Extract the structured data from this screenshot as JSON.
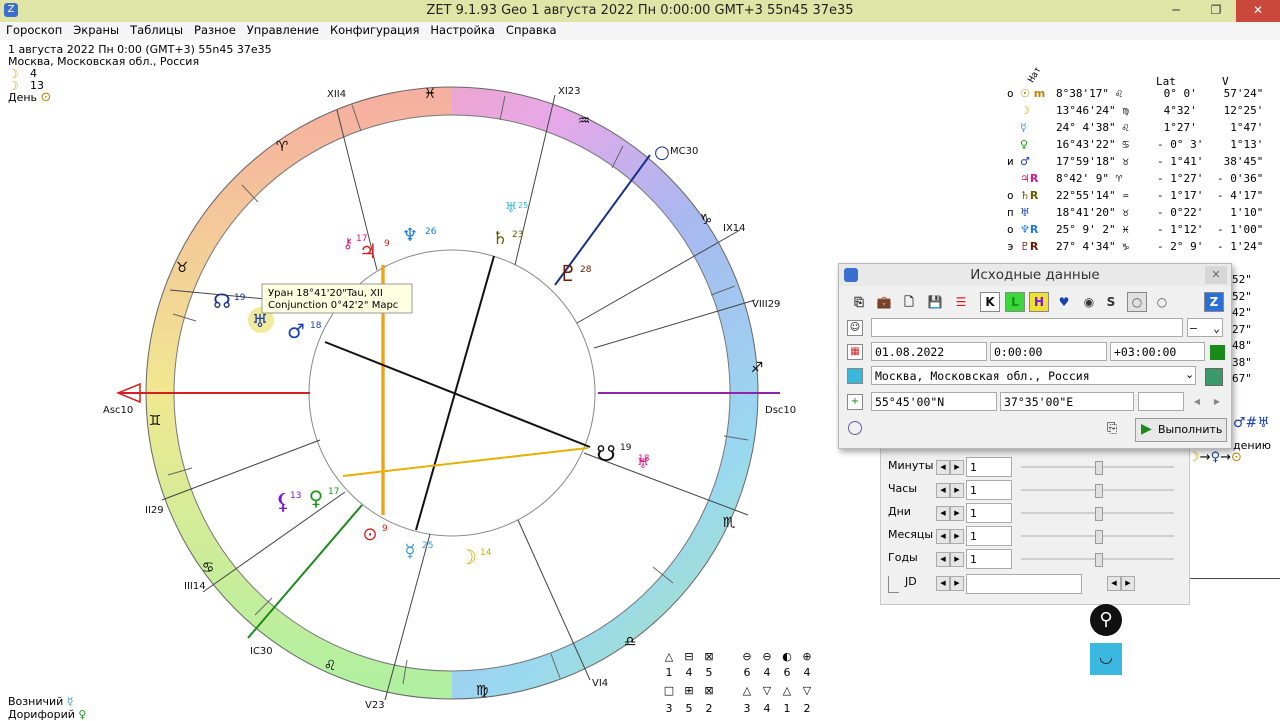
{
  "window": {
    "title": "ZET 9.1.93 Geo     1 августа 2022  Пн    0:00:00 GMT+3 55n45  37e35",
    "min": "─",
    "max": "❐",
    "close": "✕"
  },
  "menu": [
    "Гороскоп",
    "Экраны",
    "Таблицы",
    "Разное",
    "Управление",
    "Конфигурация",
    "Настройка",
    "Справка"
  ],
  "chart_info": {
    "line1": "1 августа 2022  Пн   0:00 (GMT+3) 55n45  37e35",
    "line2": "Москва, Московская обл., Россия",
    "moon_day": "4",
    "sun_day": "13",
    "day_label": "День"
  },
  "wheel": {
    "houses": [
      "Asc10",
      "XII4",
      "XI23",
      "MC30",
      "IX14",
      "VIII29",
      "Dsc10",
      "VI4",
      "V23",
      "IC30",
      "III14",
      "II29"
    ],
    "tooltip_line1": "Уран 18°41'20\"Tau, XII",
    "tooltip_line2": "Conjunction 0°42'2\" Марс",
    "planet_labels": {
      "sun": "9",
      "moon": "14",
      "mercury": "25",
      "venus": "17",
      "mars": "18",
      "jupiter": "9",
      "saturn": "23",
      "uranus": "19",
      "neptune": "26",
      "pluto": "28",
      "node": "19",
      "snode": "19",
      "lilith": "13",
      "chiron": "17",
      "cupido": "25",
      "mcnode": "18"
    }
  },
  "planet_table": {
    "header_nat": "Нат",
    "header_lat": "Lat",
    "header_v": "V",
    "rows": [
      {
        "m": "о",
        "g": "☉ m",
        "pos": "8°38'17\" ♌",
        "lat": " 0° 0'",
        "v": " 57'24\"",
        "color": "#c08000"
      },
      {
        "m": "",
        "g": "☽",
        "pos": "13°46'24\" ♍",
        "lat": " 4°32'",
        "v": " 12°25'",
        "color": "#d4a900"
      },
      {
        "m": "",
        "g": "☿",
        "pos": "24° 4'38\" ♌",
        "lat": " 1°27'",
        "v": "  1°47'",
        "color": "#3a9ad9"
      },
      {
        "m": "",
        "g": "♀",
        "pos": "16°43'22\" ♋",
        "lat": "- 0° 3'",
        "v": "  1°13'",
        "color": "#1a9a1a"
      },
      {
        "m": "и",
        "g": "♂",
        "pos": "17°59'18\" ♉",
        "lat": "- 1°41'",
        "v": " 38'45\"",
        "color": "#1a3fae"
      },
      {
        "m": "",
        "g": "♃R",
        "pos": "8°42' 9\" ♈",
        "lat": "- 1°27'",
        "v": "- 0'36\"",
        "color": "#d6168a"
      },
      {
        "m": "о",
        "g": "♄R",
        "pos": "22°55'14\" ♒",
        "lat": "- 1°17'",
        "v": "- 4'17\"",
        "color": "#6a5a00"
      },
      {
        "m": "п",
        "g": "♅",
        "pos": "18°41'20\" ♉",
        "lat": "- 0°22'",
        "v": "  1'10\"",
        "color": "#1a3fae"
      },
      {
        "m": "о",
        "g": "♆R",
        "pos": "25° 9' 2\" ♓",
        "lat": "- 1°12'",
        "v": "- 1'00\"",
        "color": "#1a7ad9"
      },
      {
        "m": "э",
        "g": "♇R",
        "pos": "27° 4'34\" ♑",
        "lat": "- 2° 9'",
        "v": "- 1'24\"",
        "color": "#6a1a00"
      }
    ],
    "partial_v": [
      "52\"",
      "52\"",
      "42\"",
      "27\"",
      "48\"",
      "38\"",
      "67\""
    ]
  },
  "dialog": {
    "title": "Исходные данные",
    "close": "✕",
    "toolbar": [
      "⎘",
      "💼",
      "🗋",
      "💾",
      "☰",
      "K",
      "L",
      "H",
      "♥",
      "◉",
      "S",
      "○",
      "○",
      "Z"
    ],
    "name_value": "",
    "name_drop": "—",
    "date": "01.08.2022",
    "time": "0:00:00",
    "tz": "+03:00:00",
    "place": "Москва, Московская обл., Россия",
    "lat": "55°45'00\"N",
    "lon": "37°35'00\"E",
    "coord_extra": "",
    "run_label": "Выполнить"
  },
  "step_panel": {
    "rows": [
      {
        "label": "Минуты",
        "value": "1"
      },
      {
        "label": "Часы",
        "value": "1"
      },
      {
        "label": "Дни",
        "value": "1"
      },
      {
        "label": "Месяцы",
        "value": "1"
      },
      {
        "label": "Годы",
        "value": "1"
      }
    ],
    "jd_label": "JD",
    "jd_value": ""
  },
  "right_extra": {
    "partial_label": "дению"
  },
  "aspects": {
    "row1_icons": [
      "△",
      "⊟",
      "⊠",
      "⊖",
      "⊖",
      "◐",
      "⊕"
    ],
    "row1_counts": [
      "1",
      "4",
      "5",
      "6",
      "4",
      "6",
      "4"
    ],
    "row2_icons": [
      "□",
      "⊞",
      "⊠",
      "△",
      "▽",
      "△",
      "▽"
    ],
    "row2_counts": [
      "3",
      "5",
      "2",
      "3",
      "4",
      "1",
      "2"
    ]
  },
  "bottom_left": {
    "line1": "Возничий",
    "line2": "Дорифорий"
  },
  "colors": {
    "accent_green": "#1a8a1a",
    "title_bg": "#dfe5a6",
    "asc_red": "#d42020",
    "dsc_purple": "#8e24aa"
  }
}
